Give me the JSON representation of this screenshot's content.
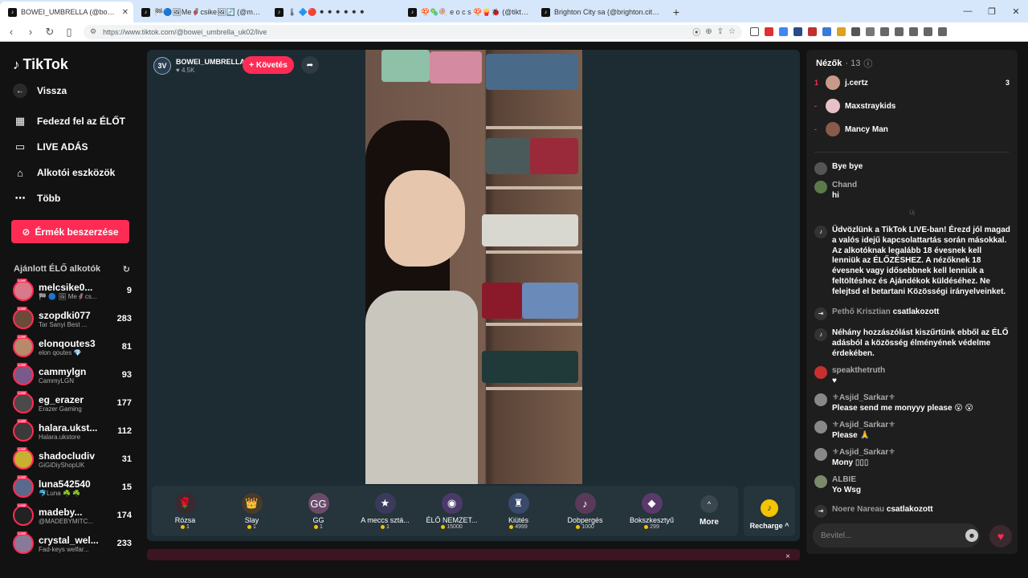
{
  "browser": {
    "tabs": [
      {
        "title": "BOWEI_UMBRELLA (@bowei",
        "active": true
      },
      {
        "title": "🏁🔵🖼Me🦸csike🖼🔄 (@melc",
        "active": false
      },
      {
        "title": "🌡 🔷🔴 ⚫ ⚫ ⚫ ⚫ ⚫ ⚫",
        "active": false
      },
      {
        "title": "🍄🦠🍭 e o c s 🍄🍟🐞 (@tiktok.rol",
        "active": false
      },
      {
        "title": "Brighton City sa (@brighton.city) ÉLŐ",
        "active": false
      }
    ],
    "new_tab": "+",
    "url": "https://www.tiktok.com/@bowei_umbrella_uk02/live"
  },
  "sidebar": {
    "logo": "TikTok",
    "back": "Vissza",
    "nav": [
      {
        "label": "Fedezd fel az ÉLŐT",
        "icon": "calendar-icon",
        "glyph": "▦"
      },
      {
        "label": "LIVE ADÁS",
        "icon": "video-icon",
        "glyph": "▭"
      },
      {
        "label": "Alkotói eszközök",
        "icon": "house-icon",
        "glyph": "⌂"
      },
      {
        "label": "Több",
        "icon": "more-icon",
        "glyph": "⋯"
      }
    ],
    "coins_button": "Érmék beszerzése",
    "recommended_title": "Ajánlott ÉLŐ alkotók",
    "creators": [
      {
        "name": "melcsike0...",
        "sub": "🏁 🔵 🖼 Me🦸cs...",
        "count": "9",
        "color": "#d97a8a"
      },
      {
        "name": "szopdki077",
        "sub": "Tar Sanyi Best ...",
        "count": "283",
        "color": "#6b4a3a"
      },
      {
        "name": "elonqoutes3",
        "sub": "elon qoutes 💎",
        "count": "81",
        "color": "#b88a6a"
      },
      {
        "name": "cammylgn",
        "sub": "CammyLGN",
        "count": "93",
        "color": "#7a5a8a"
      },
      {
        "name": "eg_erazer",
        "sub": "Erazer Gaming",
        "count": "177",
        "color": "#4a4a4a"
      },
      {
        "name": "halara.ukst...",
        "sub": "Halara.ukstore",
        "count": "112",
        "color": "#3a3a3a"
      },
      {
        "name": "shadocludiv",
        "sub": "GiGiDiyShopUK",
        "count": "31",
        "color": "#c8b030"
      },
      {
        "name": "luna542540",
        "sub": "🐬Luna ☘️ ☘️",
        "count": "15",
        "color": "#5a6a8a"
      },
      {
        "name": "madeby...",
        "sub": "@MADEBYMITC...",
        "count": "174",
        "color": "#222222"
      },
      {
        "name": "crystal_wel...",
        "sub": "Fad-keys welfar...",
        "count": "233",
        "color": "#8a7a9a"
      }
    ]
  },
  "stream": {
    "host_name": "BOWEI_UMBRELLA",
    "host_likes": "♥ 4.5K",
    "host_avatar": "3V",
    "follow": "+ Követés",
    "share_icon": "➦",
    "gifts": [
      {
        "name": "Rózsa",
        "price": "1",
        "glyph": "🌹",
        "color": "#3a2a30"
      },
      {
        "name": "Slay",
        "price": "1",
        "glyph": "👑",
        "color": "#4a3a2a"
      },
      {
        "name": "GG",
        "price": "1",
        "glyph": "GG",
        "color": "#6a4a6a"
      },
      {
        "name": "A meccs sztá...",
        "price": "1",
        "glyph": "★",
        "color": "#3a3a5a"
      },
      {
        "name": "ÉLŐ NEMZET...",
        "price": "15000",
        "glyph": "◉",
        "color": "#4a3a6a"
      },
      {
        "name": "Kiütés",
        "price": "4999",
        "glyph": "♜",
        "color": "#3a4a6a"
      },
      {
        "name": "Dobpergés",
        "price": "1000",
        "glyph": "♪",
        "color": "#5a3a5a"
      },
      {
        "name": "Bokszkesztyű",
        "price": "299",
        "glyph": "◆",
        "color": "#5a3a6a"
      }
    ],
    "more": "More",
    "more_glyph": "^",
    "recharge": "Recharge ^",
    "recharge_glyph": "♪",
    "close": "×"
  },
  "chat": {
    "viewers_label": "Nézők",
    "viewers_count": "· 13",
    "top_viewers": [
      {
        "rank": "1",
        "name": "j.certz",
        "count": "3",
        "color": "#c89a8a"
      },
      {
        "rank": "-",
        "name": "Maxstraykids",
        "count": "",
        "color": "#e8c0c8"
      },
      {
        "rank": "-",
        "name": "Mancy Man",
        "count": "",
        "color": "#8a5a4a"
      }
    ],
    "messages": [
      {
        "user": "",
        "text": "Bye bye",
        "type": "plain",
        "color": "#555"
      },
      {
        "user": "Chand",
        "text": "hi",
        "type": "user",
        "color": "#5a7a4a"
      },
      {
        "user": "",
        "text": "Üdvözlünk a TikTok LIVE-ban! Érezd jól magad a valós idejű kapcsolattartás során másokkal. Az alkotóknak legalább 18 évesnek kell lenniük az ÉLŐZÉSHEZ. A nézőknek 18 évesnek vagy idősebbnek kell lenniük a feltöltéshez és Ajándékok küldéséhez. Ne felejtsd el betartani Közösségi irányelveinket.",
        "type": "system",
        "color": "#333"
      },
      {
        "user": "Pethő Krisztian",
        "text": "csatlakozott",
        "type": "join",
        "color": "#333"
      },
      {
        "user": "",
        "text": "Néhány hozzászólást kiszűrtünk ebből az ÉLŐ adásból a közösség élményének védelme érdekében.",
        "type": "system",
        "color": "#333"
      },
      {
        "user": "speakthetruth",
        "text": "♥",
        "type": "user",
        "color": "#c83030"
      },
      {
        "user": "⚜Asjid_Sarkar⚜",
        "text": "Please send me monyyy please 😮 😮",
        "type": "user",
        "color": "#888"
      },
      {
        "user": "⚜Asjid_Sarkar⚜",
        "text": "Please 🙏",
        "type": "user",
        "color": "#888"
      },
      {
        "user": "⚜Asjid_Sarkar⚜",
        "text": "Mony ▯▯▯",
        "type": "user",
        "color": "#888"
      },
      {
        "user": "ALBIE",
        "text": "Yo Wsg",
        "type": "user",
        "color": "#7a8a6a"
      },
      {
        "user": "Noere Nareau",
        "text": "csatlakozott",
        "type": "join",
        "color": "#333"
      }
    ],
    "input_placeholder": "Bevitel...",
    "emoji_glyph": "☻",
    "heart_glyph": "♥",
    "separator": "Új"
  }
}
